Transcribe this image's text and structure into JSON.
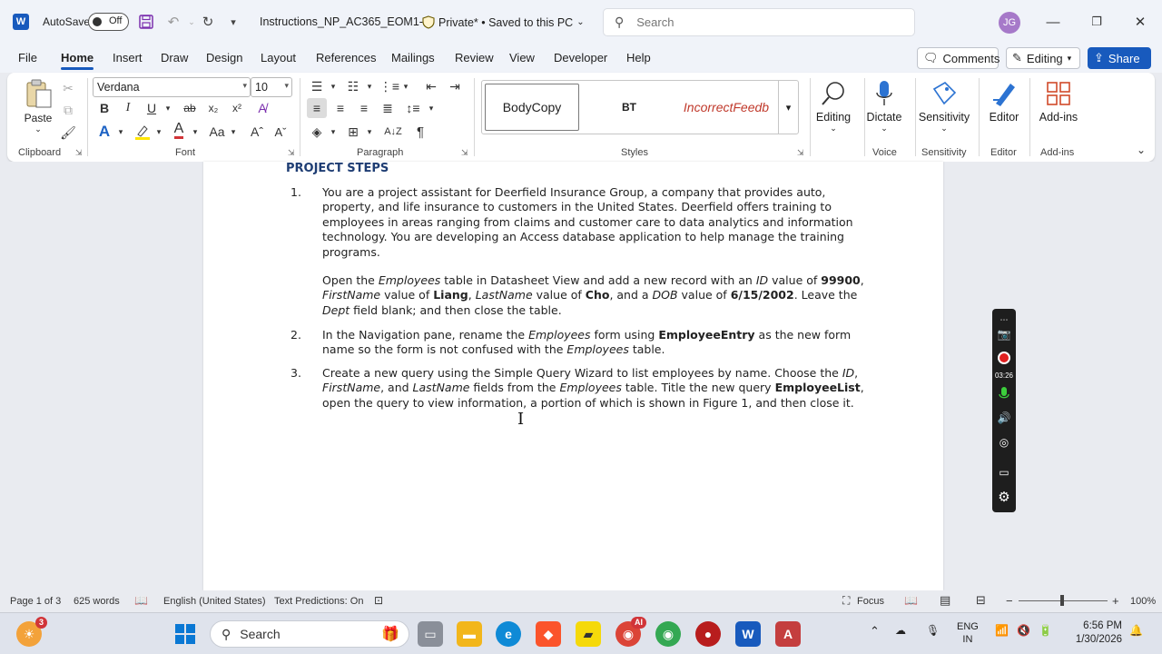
{
  "titlebar": {
    "autosave_label": "AutoSave",
    "autosave_state": "Off",
    "doc_title": "Instructions_NP_AC365_EOM1-2",
    "privacy": "Private* • Saved to this PC",
    "search_placeholder": "Search",
    "avatar_initials": "JG"
  },
  "menu": {
    "tabs": [
      "File",
      "Home",
      "Insert",
      "Draw",
      "Design",
      "Layout",
      "References",
      "Mailings",
      "Review",
      "View",
      "Developer",
      "Help"
    ],
    "active": "Home",
    "comments_label": "Comments",
    "editing_label": "Editing",
    "share_label": "Share"
  },
  "ribbon": {
    "clipboard": {
      "label": "Clipboard",
      "paste_label": "Paste"
    },
    "font": {
      "label": "Font",
      "font_name": "Verdana",
      "font_size": "10"
    },
    "paragraph": {
      "label": "Paragraph"
    },
    "styles": {
      "label": "Styles",
      "items": [
        "BodyCopy",
        "BT",
        "IncorrectFeedb"
      ]
    },
    "editing_label": "Editing",
    "voice": {
      "label": "Voice",
      "button": "Dictate"
    },
    "sensitivity": {
      "label": "Sensitivity",
      "button": "Sensitivity"
    },
    "editor": {
      "label": "Editor",
      "button": "Editor"
    },
    "addins": {
      "label": "Add-ins",
      "button": "Add-ins"
    }
  },
  "document": {
    "heading": "PROJECT STEPS",
    "steps": [
      {
        "num": "1.",
        "p1": "You are a project assistant for Deerfield Insurance Group, a company that provides auto, property, and life insurance to customers in the United States. Deerfield offers training to employees in areas ranging from claims and customer care to data analytics and information technology. You are developing an Access database application to help manage the training programs.",
        "p2": {
          "t1": "Open the ",
          "i1": "Employees",
          "t2": " table in Datasheet View and add a new record with an ",
          "i2": "ID",
          "t3": " value of ",
          "b1": "99900",
          "t4": ", ",
          "i3": "FirstName",
          "t5": " value of ",
          "b2": "Liang",
          "t6": ", ",
          "i4": "LastName",
          "t7": " value of ",
          "b3": "Cho",
          "t8": ", and a ",
          "i5": "DOB",
          "t9": " value of ",
          "b4": "6/15/2002",
          "t10": ". Leave the ",
          "i6": "Dept",
          "t11": " field blank; and then close the table."
        }
      },
      {
        "num": "2.",
        "t1": "In the Navigation pane, rename the ",
        "i1": "Employees",
        "t2": " form using ",
        "b1": "EmployeeEntry",
        "t3": " as the new form name so the form is not confused with the ",
        "i2": "Employees",
        "t4": " table."
      },
      {
        "num": "3.",
        "t1": "Create a new query using the Simple Query Wizard to list employees by name. Choose the ",
        "i1": "ID",
        "t2": ", ",
        "i2": "FirstName",
        "t3": ", and ",
        "i3": "LastName",
        "t4": " fields from the ",
        "i4": "Employees",
        "t5": " table. Title the new query ",
        "b1": "EmployeeList",
        "t6": ", open the query to view information, a portion of which is shown in Figure 1, and then close it."
      }
    ]
  },
  "recorder": {
    "time": "03:26"
  },
  "statusbar": {
    "page": "Page 1 of 3",
    "words": "625 words",
    "language": "English (United States)",
    "predictions": "Text Predictions: On",
    "focus": "Focus",
    "zoom": "100%",
    "zoom_minus": "−",
    "zoom_plus": "+"
  },
  "taskbar": {
    "search_label": "Search",
    "weather_badge": "3",
    "chrome_badge": "AI",
    "lang_line1": "ENG",
    "lang_line2": "IN",
    "time": "6:56 PM",
    "date": "1/30/2026"
  },
  "colors": {
    "accent": "#185abd",
    "heading": "#1e3d73",
    "style_feedback": "#c0392b"
  }
}
